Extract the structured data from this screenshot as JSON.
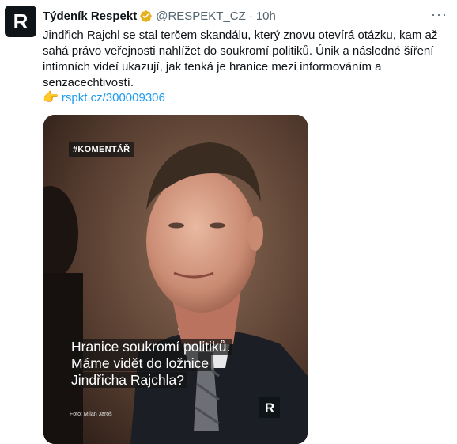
{
  "tweet": {
    "avatar_letter": "R",
    "author_name": "Týdeník Respekt",
    "handle": "@RESPEKT_CZ",
    "separator": "·",
    "time": "10h",
    "more": "···",
    "text": "Jindřich Rajchl se stal terčem skandálu, který znovu otevírá otázku, kam až sahá právo veřejnosti nahlížet do soukromí politiků. Únik a následné šíření intimních videí ukazují, jak tenká je hranice mezi informováním a senzacechtivostí.",
    "link_emoji": "👉",
    "link_text": "rspkt.cz/300009306"
  },
  "media": {
    "tag": "#KOMENTÁŘ",
    "headline_lines": [
      "Hranice soukromí politiků.",
      "Máme vidět do ložnice",
      "Jindřicha Rajchla?"
    ],
    "credit": "Foto: Milan Jaroš",
    "logo_letter": "R"
  },
  "colors": {
    "link": "#1d9bf0",
    "verified": "#e8b01f",
    "muted": "#536471"
  }
}
